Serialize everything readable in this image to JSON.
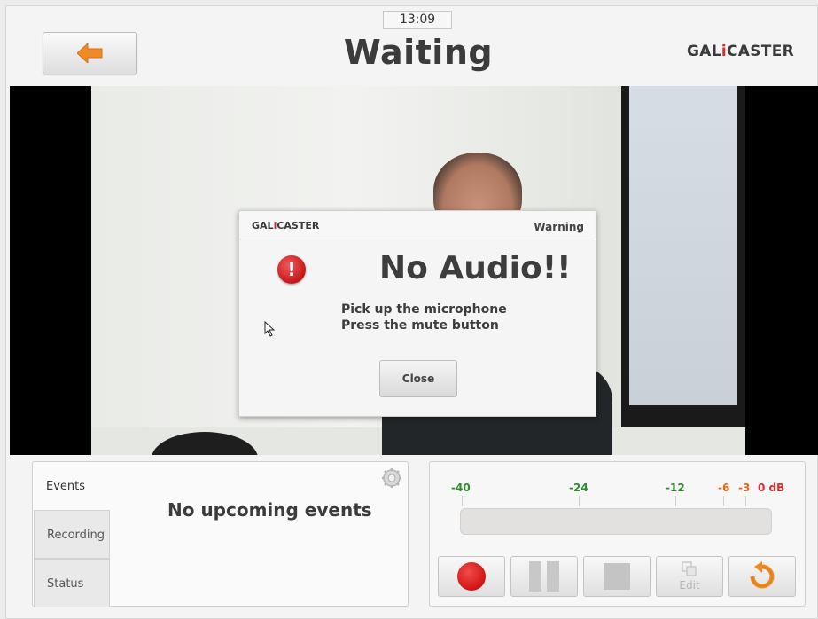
{
  "header": {
    "clock": "13:09",
    "title": "Waiting",
    "logo_main": "GAL",
    "logo_dot": "i",
    "logo_rest": "CASTER"
  },
  "dialog": {
    "logo_main": "GAL",
    "logo_dot": "i",
    "logo_rest": "CASTER",
    "type": "Warning",
    "title": "No Audio!!",
    "icon": "!",
    "lines": [
      "Pick up the microphone",
      "Press the mute button"
    ],
    "close_label": "Close"
  },
  "events_panel": {
    "tabs": [
      {
        "label": "Events",
        "active": true
      },
      {
        "label": "Recording",
        "active": false
      },
      {
        "label": "Status",
        "active": false
      }
    ],
    "message": "No upcoming events"
  },
  "audio_meter": {
    "labels": [
      {
        "text": "-40",
        "color": "#2e8b2e"
      },
      {
        "text": "-24",
        "color": "#2e8b2e"
      },
      {
        "text": "-12",
        "color": "#2e8b2e"
      },
      {
        "text": "-6",
        "color": "#e06a1b"
      },
      {
        "text": "-3",
        "color": "#e06a1b"
      },
      {
        "text": "0 dB",
        "color": "#d32f2f"
      }
    ],
    "level": 0
  },
  "controls": {
    "edit_label": "Edit"
  },
  "colors": {
    "accent_orange": "#f08a24",
    "record_red": "#d11414"
  }
}
